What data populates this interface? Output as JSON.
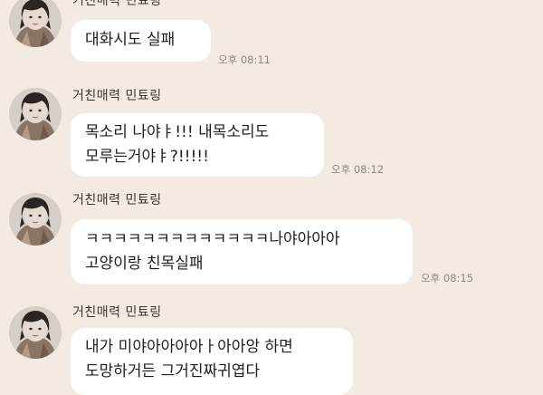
{
  "chat": {
    "messages": [
      {
        "sender": "거친매력 민툐링",
        "lines": [
          "대화시도 실패"
        ],
        "time": "오후 08:11"
      },
      {
        "sender": "거친매력 민툐링",
        "lines": [
          "목소리 나야ㅑ!!! 내목소리도",
          "모루는거야ㅑ?!!!!!"
        ],
        "time": "오후 08:12"
      },
      {
        "sender": "거친매력 민툐링",
        "lines": [
          "ㅋㅋㅋㅋㅋㅋㅋㅋㅋㅋㅋㅋㅋ나야아아아",
          "고양이랑 친목실패"
        ],
        "time": "오후 08:15"
      },
      {
        "sender": "거친매력 민툐링",
        "lines": [
          "내가 미야아아아아ㅏ아아앙 하면",
          "도망하거든 그거진짜귀엽다"
        ],
        "time": ""
      }
    ]
  },
  "colors": {
    "background": "#f3ebe1",
    "bubble": "#ffffff",
    "timestamp": "#8d8782"
  },
  "icons": {
    "avatar": "profile-photo"
  }
}
